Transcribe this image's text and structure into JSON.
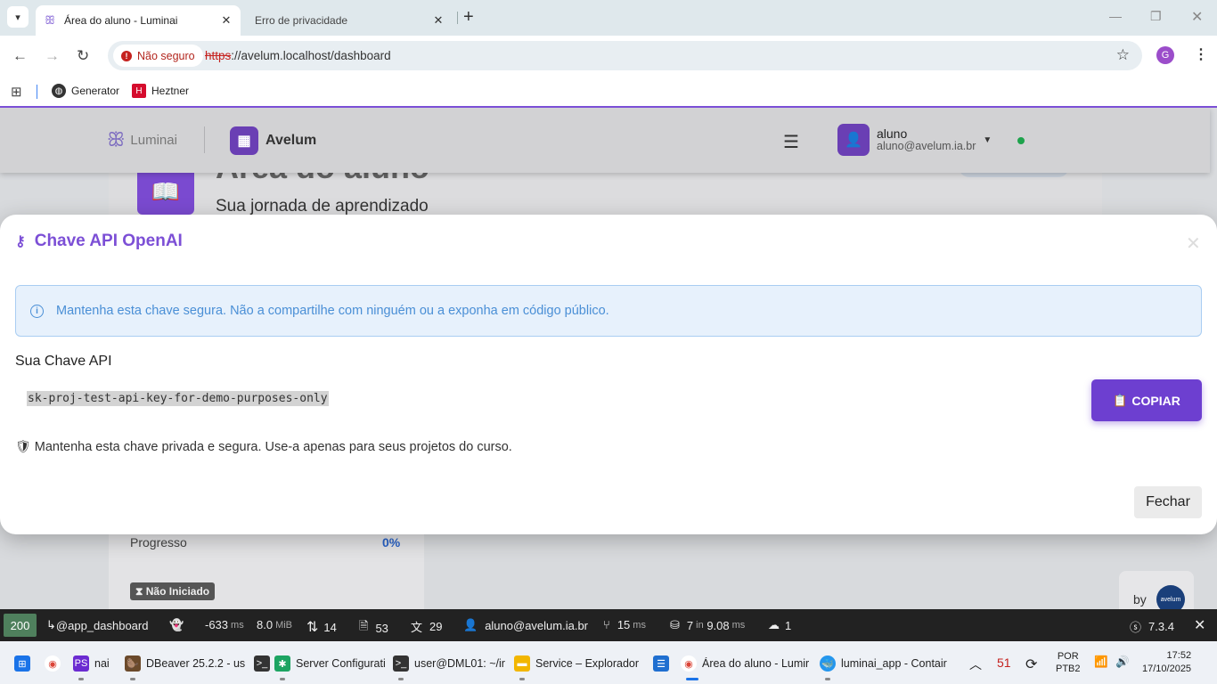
{
  "browser": {
    "tabs": [
      {
        "title": "Área do aluno - Luminai",
        "active": true
      },
      {
        "title": "Erro de privacidade",
        "active": false
      }
    ],
    "security_chip": "Não seguro",
    "url_scheme": "https",
    "url_rest": "://avelum.localhost/dashboard",
    "profile_initial": "G",
    "bookmarks": [
      {
        "label": "Generator",
        "icon": "globe-icon"
      },
      {
        "label": "Heztner",
        "icon": "hetzner-icon"
      }
    ]
  },
  "app": {
    "brand": "Luminai",
    "workspace": "Avelum",
    "user": {
      "name": "aluno",
      "email": "aluno@avelum.ia.br",
      "status_color": "#1ea34c"
    }
  },
  "background": {
    "title": "Área do aluno",
    "subtitle": "Sua jornada de aprendizado",
    "progress_label": "Progresso",
    "progress_value": "0%",
    "status_badge": "Não Iniciado",
    "by_label": "by",
    "by_logo": "avelum"
  },
  "modal": {
    "title": "Chave API OpenAI",
    "alert": "Mantenha esta chave segura. Não a compartilhe com ninguém ou a exponha em código público.",
    "key_label": "Sua Chave API",
    "key_value": "sk-proj-test-api-key-for-demo-purposes-only",
    "copy_label": "COPIAR",
    "note": "Mantenha esta chave privada e segura. Use-a apenas para seus projetos do curso.",
    "close_label": "Fechar",
    "accent": "#7c4fd6"
  },
  "devbar": {
    "status": "200",
    "route": "@app_dashboard",
    "time": "-633",
    "time_unit": "ms",
    "memory": "8.0",
    "memory_unit": "MiB",
    "requests": "14",
    "forms": "53",
    "translations": "29",
    "user": "aluno@avelum.ia.br",
    "twig_time": "15",
    "twig_unit": "ms",
    "db_queries": "7",
    "db_in": "in",
    "db_time": "9.08",
    "db_unit": "ms",
    "http_clients": "1",
    "version": "7.3.4"
  },
  "taskbar": {
    "items": [
      "nai",
      "DBeaver 25.2.2 - us",
      "Server Configurati",
      "user@DML01: ~/ir",
      "Service – Explorador c",
      "Área do aluno - Lumir",
      "luminai_app - Contair"
    ],
    "counter": "51",
    "lang": "POR",
    "layout": "PTB2",
    "time": "17:52",
    "date": "17/10/2025"
  }
}
